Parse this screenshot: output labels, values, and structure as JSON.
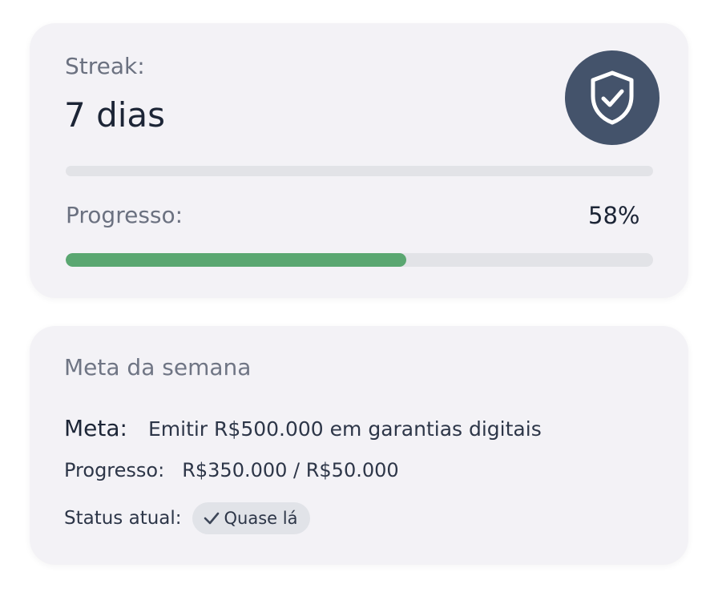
{
  "streak_card": {
    "streak_label": "Streak:",
    "streak_value": "7 dias",
    "badge_icon": "shield-check-icon",
    "progress_label": "Progresso:",
    "progress_percent_text": "58%",
    "progress_fraction": 0.58,
    "colors": {
      "badge_bg": "#44536b",
      "progress_fill": "#5aa771",
      "track": "#e2e3e7"
    }
  },
  "meta_card": {
    "title": "Meta da semana",
    "goal_label": "Meta:",
    "goal_value": "Emitir R$500.000 em garantias digitais",
    "progress_label": "Progresso:",
    "progress_value": "R$350.000 / R$50.000",
    "status_label": "Status atual:",
    "status_icon": "checkmark-icon",
    "status_value": "Quase lá"
  }
}
